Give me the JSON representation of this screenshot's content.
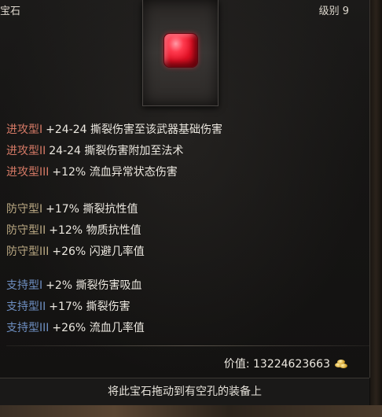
{
  "header": {
    "title": "宝石",
    "level": "级别 9"
  },
  "gem": {
    "icon": "red-gem-icon",
    "color": "#e01024"
  },
  "affixes": {
    "offense": [
      {
        "prefix": "进攻型I",
        "stat": "+24-24 撕裂伤害至该武器基础伤害"
      },
      {
        "prefix": "进攻型II",
        "stat": "24-24 撕裂伤害附加至法术"
      },
      {
        "prefix": "进攻型III",
        "stat": "+12% 流血异常状态伤害"
      }
    ],
    "defense": [
      {
        "prefix": "防守型I",
        "stat": "+17% 撕裂抗性值"
      },
      {
        "prefix": "防守型II",
        "stat": "+12% 物质抗性值"
      },
      {
        "prefix": "防守型III",
        "stat": "+26% 闪避几率值"
      }
    ],
    "support": [
      {
        "prefix": "支持型I",
        "stat": "+2% 撕裂伤害吸血"
      },
      {
        "prefix": "支持型II",
        "stat": "+17% 撕裂伤害"
      },
      {
        "prefix": "支持型III",
        "stat": "+26% 流血几率值"
      }
    ]
  },
  "colors": {
    "offense": "#d67a66",
    "defense": "#bba983",
    "support": "#6e8fc2"
  },
  "price": {
    "text": "价值: 13224623663",
    "icon": "gold-coins-icon"
  },
  "hint": "将此宝石拖动到有空孔的装备上"
}
